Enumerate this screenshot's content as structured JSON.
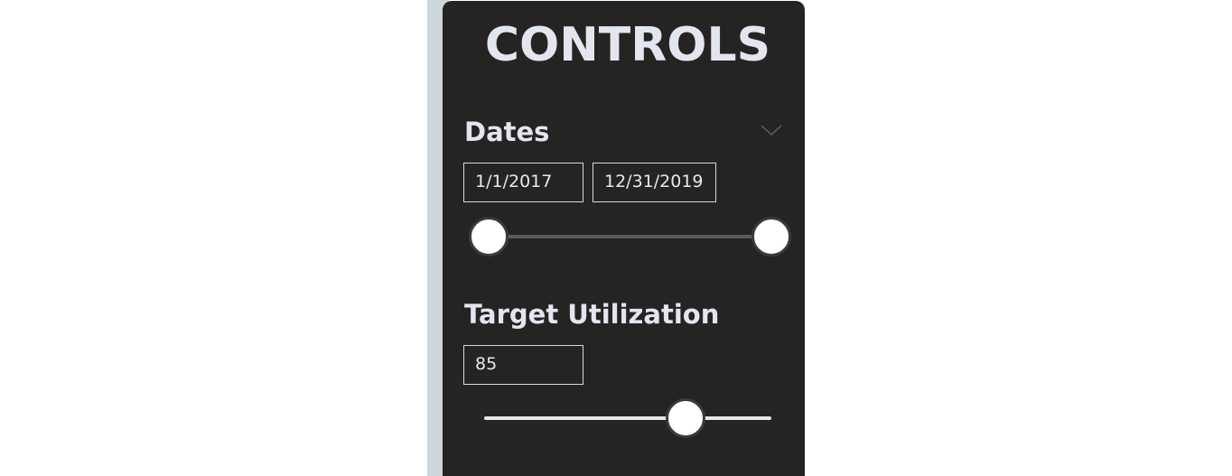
{
  "panel": {
    "title": "CONTROLS"
  },
  "dates": {
    "label": "Dates",
    "start_value": "1/1/2017",
    "end_value": "12/31/2019",
    "toggle_icon": "chevron-down-icon"
  },
  "target_utilization": {
    "label": "Target Utilization",
    "value": "85",
    "slider_fraction": 0.7
  },
  "colors": {
    "panel_background": "#252423",
    "edge_strip": "#ccd6db",
    "text": "#e3e6ef",
    "thumb": "#ffffff"
  }
}
